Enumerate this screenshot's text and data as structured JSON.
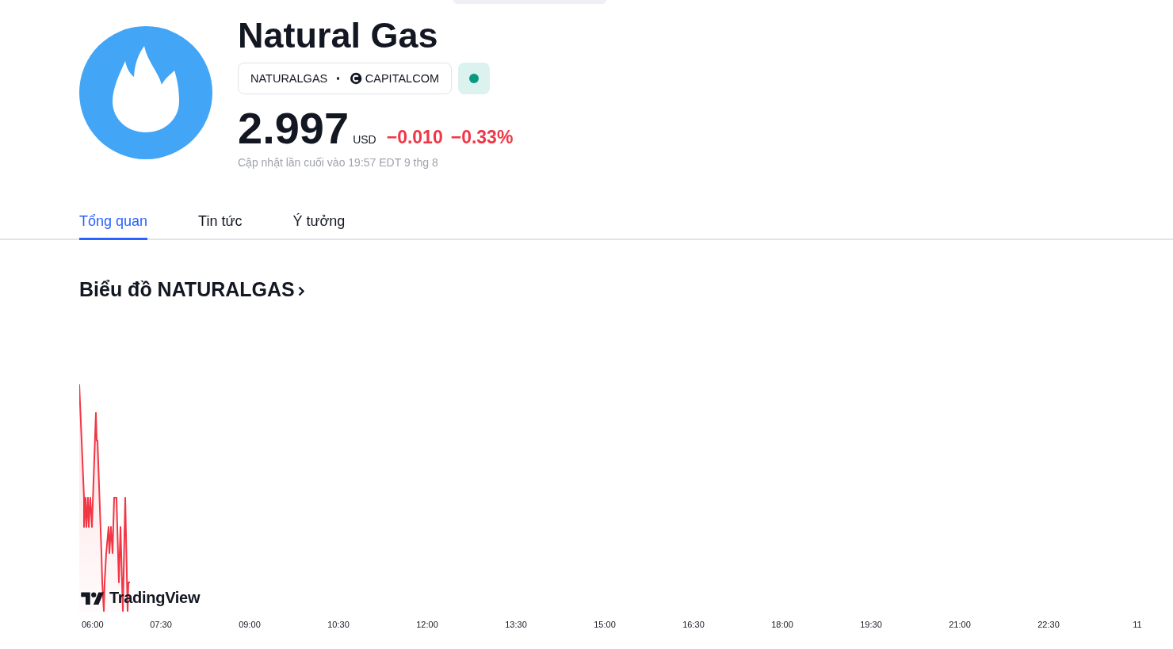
{
  "header": {
    "title": "Natural Gas",
    "symbol": "NATURALGAS",
    "exchange": "CAPITALCOM",
    "market_open": true,
    "price": "2.997",
    "currency": "USD",
    "change_negative": true,
    "change": "−0.010",
    "change_percent": "−0.33%",
    "last_update": "Cập nhật lần cuối vào 19:57 EDT 9 thg 8"
  },
  "tabs": [
    {
      "label": "Tổng quan",
      "selected": true
    },
    {
      "label": "Tin tức",
      "selected": false
    },
    {
      "label": "Ý tưởng",
      "selected": false
    }
  ],
  "chart_section": {
    "heading": "Biểu đồ NATURALGAS",
    "brand": "TradingView",
    "time_labels": [
      "06:00",
      "07:30",
      "09:00",
      "10:30",
      "12:00",
      "13:30",
      "15:00",
      "16:30",
      "18:00",
      "19:30",
      "21:00",
      "22:30",
      "11"
    ]
  }
}
